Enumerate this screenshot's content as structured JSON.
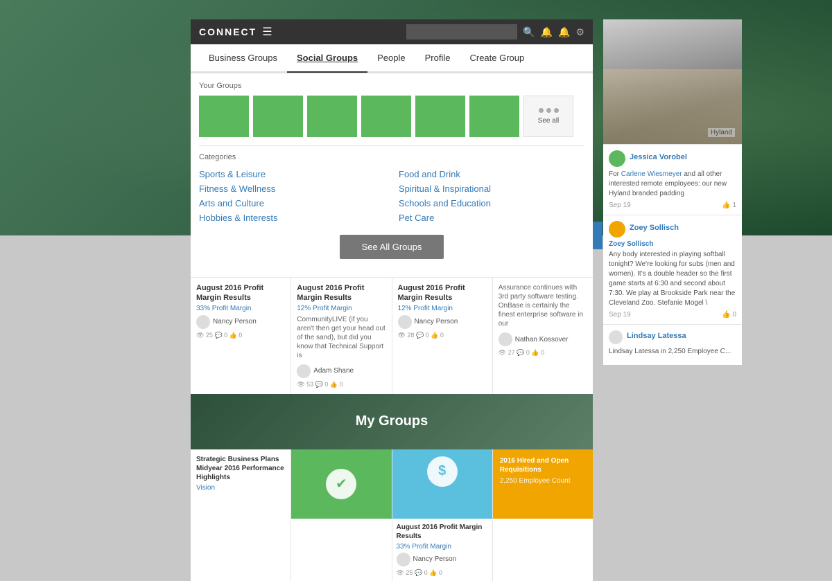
{
  "app": {
    "name": "CONNECT",
    "search_placeholder": ""
  },
  "header": {
    "icons": [
      "bell",
      "bell2",
      "gear"
    ]
  },
  "nav": {
    "tabs": [
      {
        "id": "business-groups",
        "label": "Business Groups",
        "active": false
      },
      {
        "id": "social-groups",
        "label": "Social Groups",
        "active": true
      },
      {
        "id": "people",
        "label": "People",
        "active": false
      },
      {
        "id": "profile",
        "label": "Profile",
        "active": false
      },
      {
        "id": "create-group",
        "label": "Create Group",
        "active": false
      }
    ]
  },
  "your_groups": {
    "label": "Your Groups",
    "see_all": "See all",
    "count": 6
  },
  "categories": {
    "label": "Categories",
    "left": [
      "Sports & Leisure",
      "Fitness & Wellness",
      "Arts and Culture",
      "Hobbies & Interests"
    ],
    "right": [
      "Food and Drink",
      "Spiritual & Inspirational",
      "Schools and Education",
      "Pet Care"
    ]
  },
  "see_all_btn": "See All Groups",
  "posts": [
    {
      "title": "August 2016 Profit Margin Results",
      "subtitle": "33% Profit Margin",
      "author": "Nancy Person",
      "stats": "👁 25  💬 0  👍 0"
    },
    {
      "title": "August 2016 Profit Margin Results",
      "subtitle": "12% Profit Margin",
      "text": "CommunityLIVE (if you aren't then get your head out of the sand), but did you know that Technical Support is",
      "author": "Adam Shane",
      "stats": "👁 53  💬 0  👍 0"
    },
    {
      "title": "August 2016 Profit Margin Results",
      "subtitle": "12% Profit Margin",
      "author": "Nancy Person",
      "stats": "👁 28  💬 0  👍 0"
    },
    {
      "title": "",
      "subtitle": "",
      "text": "Assurance continues with 3rd party software testing. OnBase is certainly the finest enterprise software in our",
      "author": "Nathan Kossover",
      "stats": "👁 27  💬 0  👍 0"
    }
  ],
  "my_groups": {
    "label": "My Groups"
  },
  "group_cards": [
    {
      "type": "white",
      "title": "Strategic Business Plans Midyear 2016 Performance Highlights",
      "sub": "Vision"
    },
    {
      "type": "green",
      "icon": "✔",
      "title": "",
      "sub": ""
    },
    {
      "type": "blue",
      "icon": "$",
      "title": "August 2016 Profit Margin Results",
      "subtitle": "33% Profit Margin",
      "author": "Nancy Person",
      "stats": "👁 25  💬 0  👍 0"
    },
    {
      "type": "orange",
      "title": "2016 Hired and Open Requisitions",
      "count": "2,250 Employee Count"
    }
  ],
  "sidebar": {
    "user1": {
      "name": "Jessica Vorobel",
      "mention": "Carlene Wiesmeyer",
      "text": "and all other interested remote employees: our new Hyland branded padding",
      "date": "Sep 19",
      "likes": "1"
    },
    "user2": {
      "name": "Zoey Sollisch",
      "header": "Zoey Sollisch",
      "text": "Any body interested in playing softball tonight? We're looking for subs (men and women). It's a double header so the first game starts at 6:30 and second about 7:30. We play at Brookside Park near the Cleveland Zoo. Stefanie Mogel \\",
      "date": "Sep 19",
      "likes": "0"
    },
    "user3": {
      "name": "Lindsay Latessa",
      "text": "Lindsay Latessa in 2,250 Employee C..."
    }
  }
}
